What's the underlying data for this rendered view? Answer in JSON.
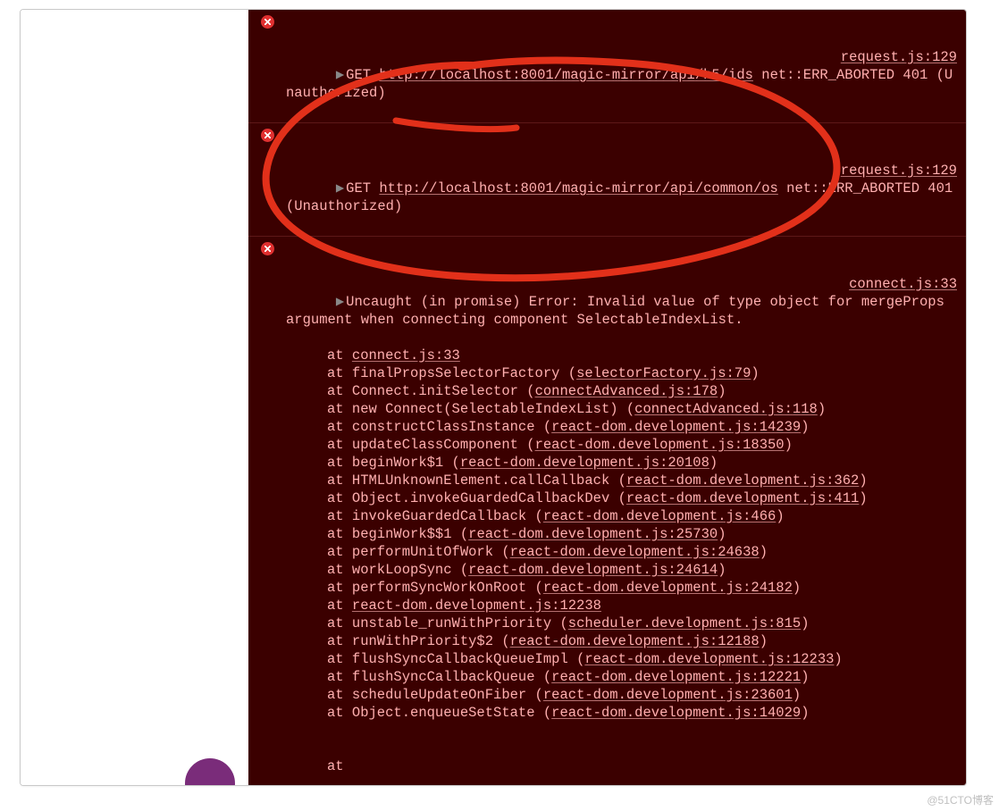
{
  "watermark": "@51CTO博客",
  "console": {
    "entries": [
      {
        "method": "GET",
        "url": "http://localhost:8001/magic-mirror/api/h5/ids",
        "status": "net::ERR_ABORTED 401 (Unauthorized)",
        "source": "request.js:129"
      },
      {
        "method": "GET",
        "url": "http://localhost:8001/magic-mirror/api/common/os",
        "status": "net::ERR_ABORTED 401 (Unauthorized)",
        "source": "request.js:129"
      },
      {
        "message_head": "Uncaught (in promise) Error: Invalid value of ",
        "message_tail": "type object for mergeProps argument when connecting component SelectableIndexList.",
        "source": "connect.js:33",
        "stack": [
          {
            "at": "at ",
            "fn": "",
            "loc": "connect.js:33"
          },
          {
            "at": "at ",
            "fn": "finalPropsSelectorFactory ",
            "loc": "selectorFactory.js:79"
          },
          {
            "at": "at ",
            "fn": "Connect.initSelector ",
            "loc": "connectAdvanced.js:178"
          },
          {
            "at": "at ",
            "fn": "new Connect(SelectableIndexList) ",
            "loc": "connectAdvanced.js:118"
          },
          {
            "at": "at ",
            "fn": "constructClassInstance ",
            "loc": "react-dom.development.js:14239"
          },
          {
            "at": "at ",
            "fn": "updateClassComponent ",
            "loc": "react-dom.development.js:18350"
          },
          {
            "at": "at ",
            "fn": "beginWork$1 ",
            "loc": "react-dom.development.js:20108"
          },
          {
            "at": "at ",
            "fn": "HTMLUnknownElement.callCallback ",
            "loc": "react-dom.development.js:362"
          },
          {
            "at": "at ",
            "fn": "Object.invokeGuardedCallbackDev ",
            "loc": "react-dom.development.js:411"
          },
          {
            "at": "at ",
            "fn": "invokeGuardedCallback ",
            "loc": "react-dom.development.js:466"
          },
          {
            "at": "at ",
            "fn": "beginWork$$1 ",
            "loc": "react-dom.development.js:25730"
          },
          {
            "at": "at ",
            "fn": "performUnitOfWork ",
            "loc": "react-dom.development.js:24638"
          },
          {
            "at": "at ",
            "fn": "workLoopSync ",
            "loc": "react-dom.development.js:24614"
          },
          {
            "at": "at ",
            "fn": "performSyncWorkOnRoot ",
            "loc": "react-dom.development.js:24182"
          },
          {
            "at": "at ",
            "fn": "",
            "loc": "react-dom.development.js:12238",
            "noparen": true
          },
          {
            "at": "at ",
            "fn": "unstable_runWithPriority ",
            "loc": "scheduler.development.js:815"
          },
          {
            "at": "at ",
            "fn": "runWithPriority$2 ",
            "loc": "react-dom.development.js:12188"
          },
          {
            "at": "at ",
            "fn": "flushSyncCallbackQueueImpl ",
            "loc": "react-dom.development.js:12233"
          },
          {
            "at": "at ",
            "fn": "flushSyncCallbackQueue ",
            "loc": "react-dom.development.js:12221"
          },
          {
            "at": "at ",
            "fn": "scheduleUpdateOnFiber ",
            "loc": "react-dom.development.js:23601"
          },
          {
            "at": "at ",
            "fn": "Object.enqueueSetState ",
            "loc": "react-dom.development.js:14029"
          }
        ],
        "trailing_at": "at"
      }
    ]
  }
}
